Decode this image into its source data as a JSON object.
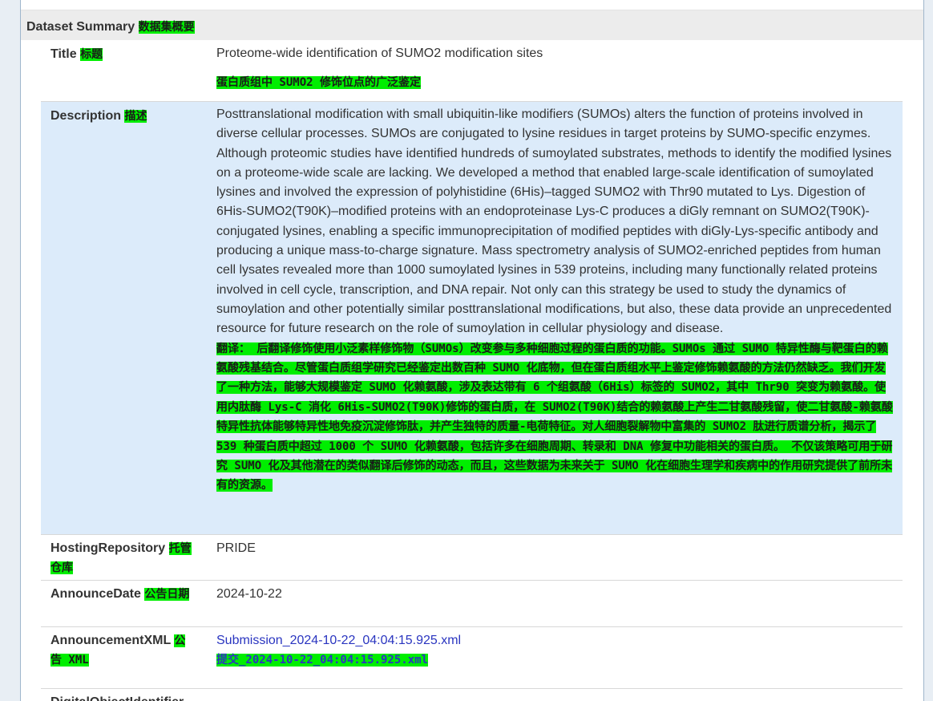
{
  "section": {
    "title": "Dataset Summary",
    "title_cn": "数据集概要"
  },
  "rows": {
    "title": {
      "key": "Title",
      "key_cn": "标题",
      "value": "Proteome-wide identification of SUMO2 modification sites",
      "value_cn": "蛋白质组中 SUMO2 修饰位点的广泛鉴定"
    },
    "description": {
      "key": "Description",
      "key_cn": "描述",
      "value": "Posttranslational modification with small ubiquitin-like modifiers (SUMOs) alters the function of proteins involved in diverse cellular processes. SUMOs are conjugated to lysine residues in target proteins by SUMO-specific enzymes. Although proteomic studies have identified hundreds of sumoylated substrates, methods to identify the modified lysines on a proteome-wide scale are lacking. We developed a method that enabled large-scale identification of sumoylated lysines and involved the expression of polyhistidine (6His)–tagged SUMO2 with Thr90 mutated to Lys. Digestion of 6His-SUMO2(T90K)–modified proteins with an endoproteinase Lys-C produces a diGly remnant on SUMO2(T90K)-conjugated lysines, enabling a specific immunoprecipitation of modified peptides with diGly-Lys-specific antibody and producing a unique mass-to-charge signature. Mass spectrometry analysis of SUMO2-enriched peptides from human cell lysates revealed more than 1000 sumoylated lysines in 539 proteins, including many functionally related proteins involved in cell cycle, transcription, and DNA repair. Not only can this strategy be used to study the dynamics of sumoylation and other potentially similar posttranslational modifications, but also, these data provide an unprecedented resource for future research on the role of sumoylation in cellular physiology and disease.",
      "value_cn": "翻译： 后翻译修饰使用小泛素样修饰物（SUMOs）改变参与多种细胞过程的蛋白质的功能。SUMOs 通过 SUMO 特异性酶与靶蛋白的赖氨酸残基结合。尽管蛋白质组学研究已经鉴定出数百种 SUMO 化底物，但在蛋白质组水平上鉴定修饰赖氨酸的方法仍然缺乏。我们开发了一种方法，能够大规模鉴定 SUMO 化赖氨酸，涉及表达带有 6 个组氨酸（6His）标签的 SUMO2，其中 Thr90 突变为赖氨酸。使用内肽酶 Lys-C 消化 6His-SUMO2(T90K)修饰的蛋白质，在 SUMO2(T90K)结合的赖氨酸上产生二甘氨酸残留，使二甘氨酸-赖氨酸特异性抗体能够特异性地免疫沉淀修饰肽，并产生独特的质量-电荷特征。对人细胞裂解物中富集的 SUMO2 肽进行质谱分析，揭示了 539 种蛋白质中超过 1000 个 SUMO 化赖氨酸，包括许多在细胞周期、转录和 DNA 修复中功能相关的蛋白质。 不仅该策略可用于研究 SUMO 化及其他潜在的类似翻译后修饰的动态，而且，这些数据为未来关于 SUMO 化在细胞生理学和疾病中的作用研究提供了前所未有的资源。"
    },
    "hosting": {
      "key": "HostingRepository",
      "key_cn": "托管仓库",
      "value": "PRIDE"
    },
    "date": {
      "key": "AnnounceDate",
      "key_cn": "公告日期",
      "value": "2024-10-22"
    },
    "xml": {
      "key": "AnnouncementXML",
      "key_cn": "公告 XML",
      "value": "Submission_2024-10-22_04:04:15.925.xml",
      "value_cn": "提交_2024-10-22_04:04:15.925.xml"
    },
    "doi": {
      "key": "DigitalObjectIdentifier"
    }
  },
  "colors": {
    "highlight": "#00ee00",
    "row_highlight": "#dcebfa",
    "link": "#2a35c0",
    "header_bg": "#ececec"
  }
}
